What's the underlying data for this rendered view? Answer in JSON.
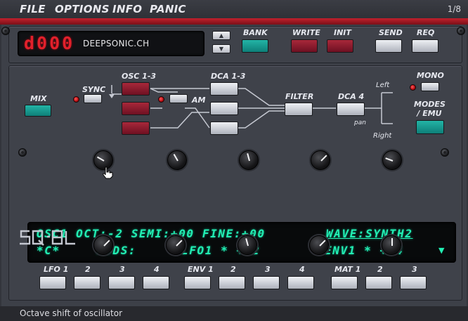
{
  "menu": {
    "file": "FILE",
    "options": "OPTIONS",
    "info": "INFO",
    "panic": "PANIC"
  },
  "page_indicator": "1/8",
  "display": {
    "segment_value": "d000",
    "name": "DEEPSONIC.CH"
  },
  "top_buttons": {
    "bank": "BANK",
    "write": "WRITE",
    "init": "INIT",
    "send": "SEND",
    "req": "REQ"
  },
  "colors": {
    "accent_red": "#c2202c",
    "teal": "#14968e",
    "lcd_text": "#22f0b4",
    "segment": "#e2202b"
  },
  "routing": {
    "mix": "MIX",
    "sync": "SYNC",
    "osc": "OSC 1-3",
    "dca": "DCA 1-3",
    "am": "AM",
    "filter": "FILTER",
    "dca4": "DCA 4",
    "left": "Left",
    "right": "Right",
    "pan": "pan",
    "mono": "MONO",
    "modes_line1": "MODES",
    "modes_line2": "/ EMU"
  },
  "lcd": {
    "line1_left": "OSC1 OCT:-2 SEMI:+00 FINE:+00",
    "line1_right": "WAVE:SYNTH2",
    "line2_a": "*C*",
    "line2_b": "MODS:",
    "line2_c": "LFO1 * +02",
    "line2_d": "ENV1 * +04",
    "scroll_icon": "triangle-down-icon"
  },
  "logo": "SQ-8L",
  "knob_levels": {
    "row1": [
      -60,
      -30,
      -15,
      45,
      -70
    ],
    "row2": [
      45,
      45,
      -15,
      45,
      0
    ]
  },
  "bottom_groups": {
    "lfo": {
      "label": "LFO 1",
      "items": [
        "2",
        "3",
        "4"
      ]
    },
    "env": {
      "label": "ENV 1",
      "items": [
        "2",
        "3",
        "4"
      ]
    },
    "mat": {
      "label": "MAT 1",
      "items": [
        "2",
        "3"
      ]
    }
  },
  "status": "Octave shift of oscillator"
}
